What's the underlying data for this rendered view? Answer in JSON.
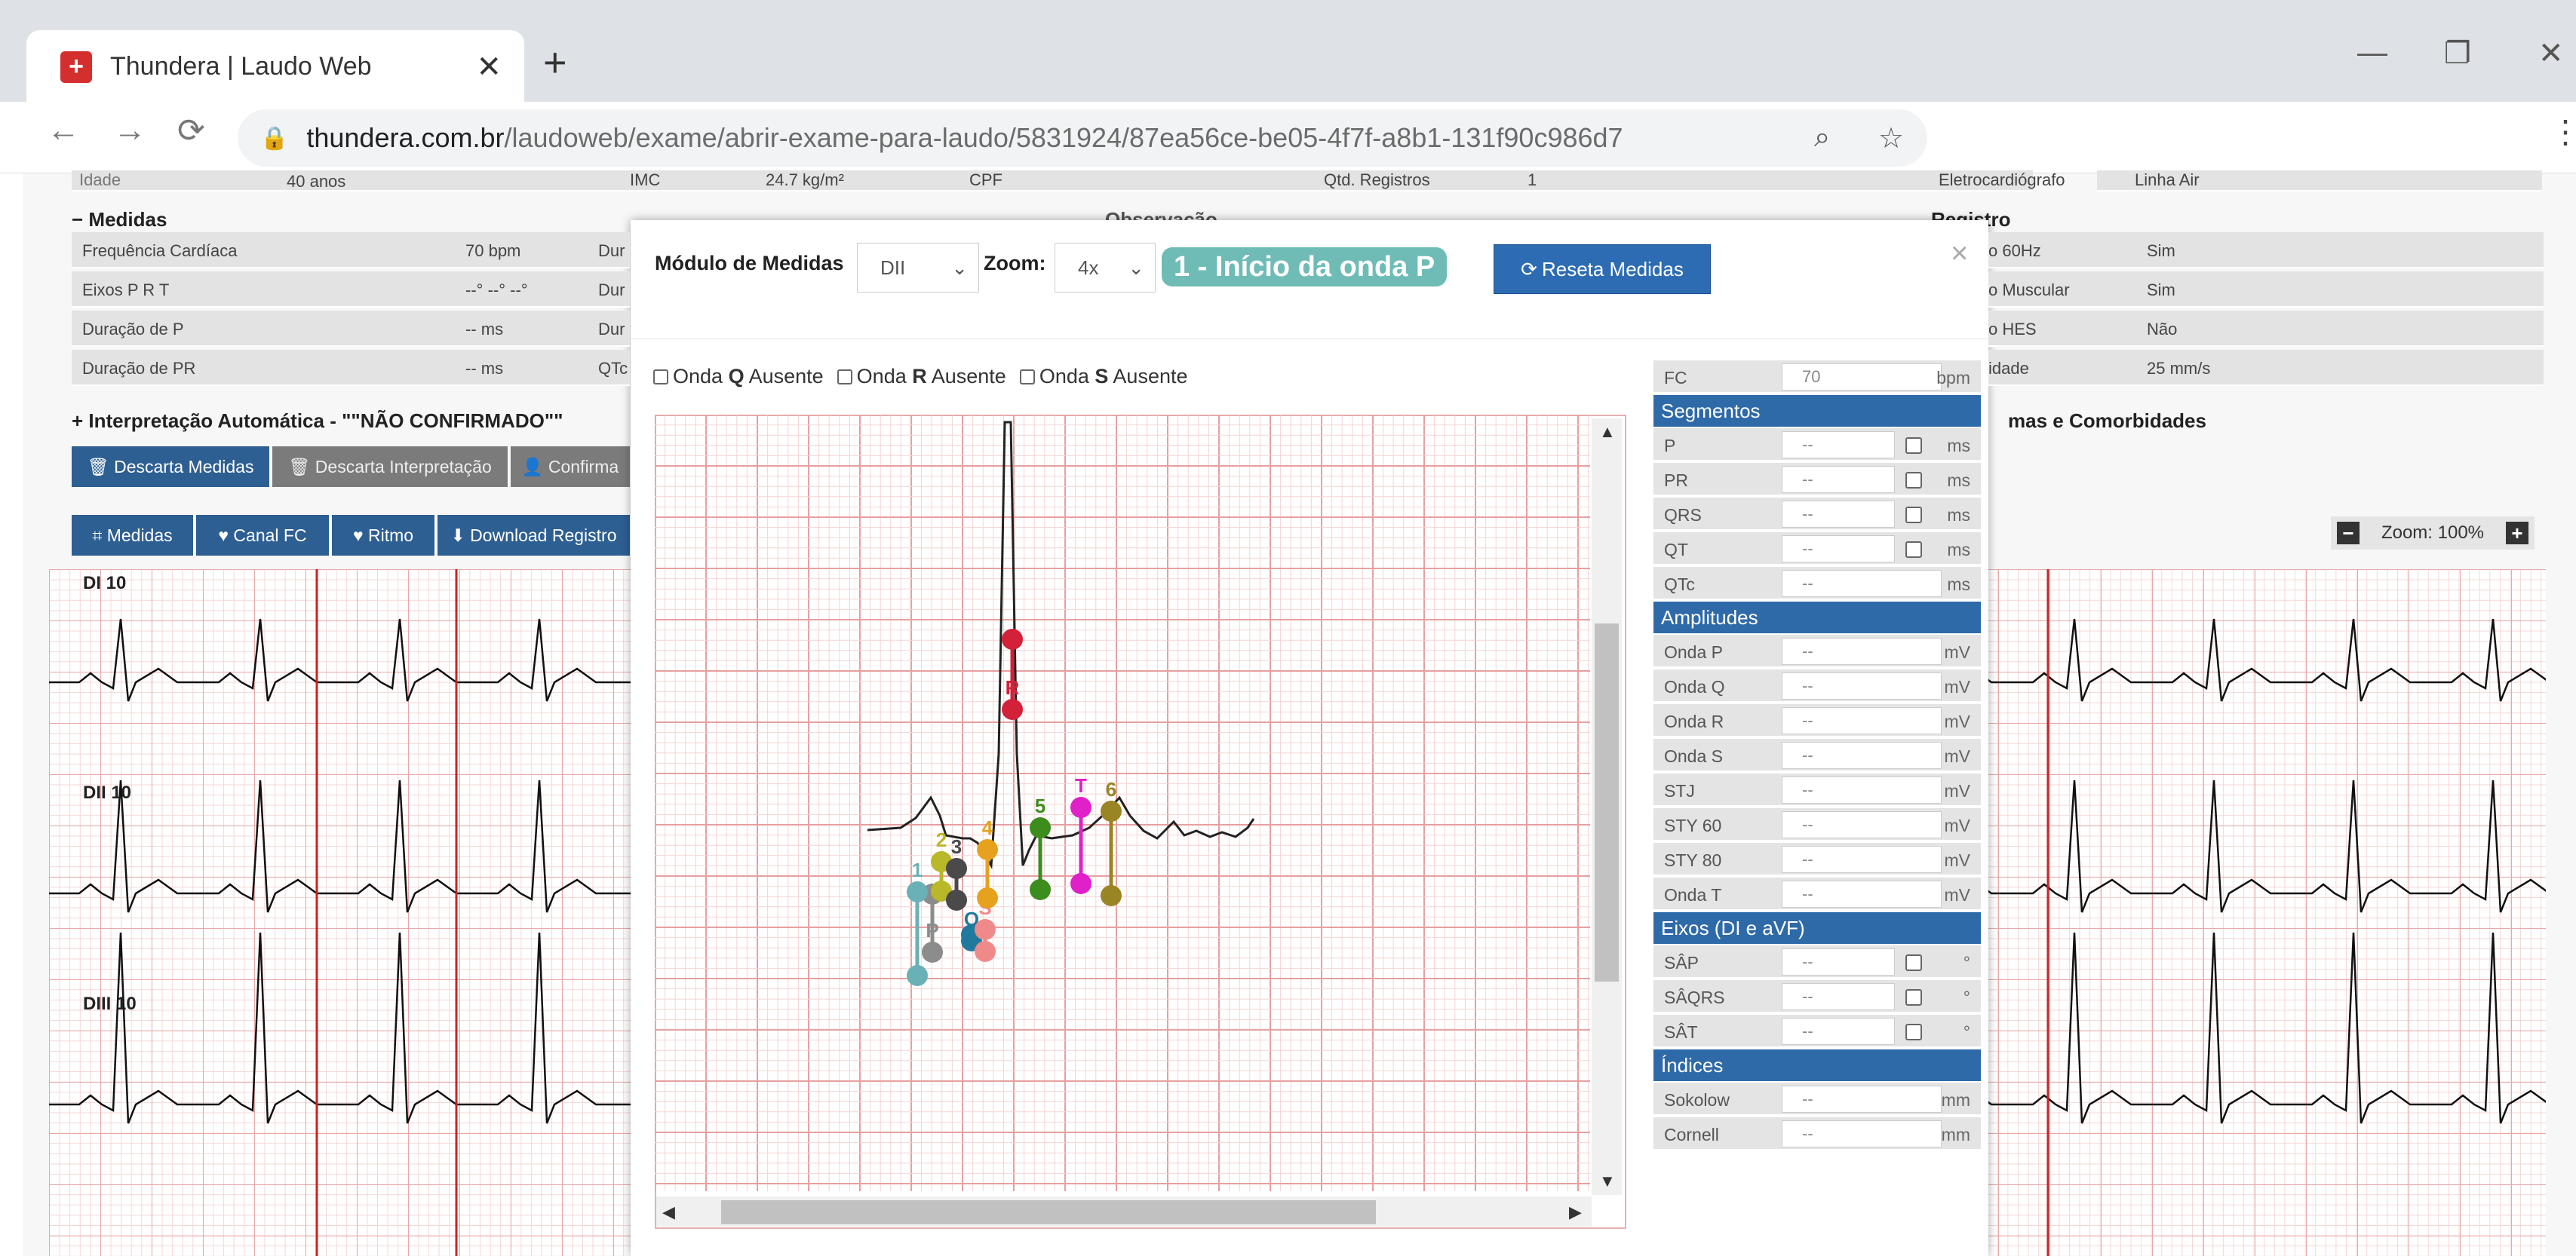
{
  "browser": {
    "tab_title": "Thundera | Laudo Web",
    "favicon": "thundera-favicon",
    "url_host": "thundera.com.br",
    "url_path": "/laudoweb/exame/abrir-exame-para-laudo/5831924/87ea56ce-be05-4f7f-a8b1-131f90c986d7"
  },
  "background": {
    "top_partial": {
      "idade_label": "Idade",
      "idade_value": "40 anos",
      "imc": "IMC",
      "imc_value": "24.7 kg/m²",
      "cpf": "CPF",
      "qtd_label": "Qtd. Registros",
      "qtd_value": "1",
      "ecg_label": "Eletrocardiógrafo",
      "ecg_value": "Linha Air"
    },
    "medidas_title": "− Medidas",
    "medidas_rows": [
      {
        "label": "Frequência Cardíaca",
        "value": "70 bpm",
        "next": "Dur"
      },
      {
        "label": "Eixos P R T",
        "value": "--° --° --°",
        "next": "Dur"
      },
      {
        "label": "Duração de P",
        "value": "-- ms",
        "next": "Dur"
      },
      {
        "label": "Duração de PR",
        "value": "-- ms",
        "next": "QTc"
      }
    ],
    "obs_partial": "Observação",
    "registro_title": "Registro",
    "registro_rows": [
      {
        "label": "o 60Hz",
        "value": "Sim"
      },
      {
        "label": "o Muscular",
        "value": "Sim"
      },
      {
        "label": "o HES",
        "value": "Não"
      },
      {
        "label": "idade",
        "value": "25 mm/s"
      }
    ],
    "interp_title": "+ Interpretação Automática - \"\"NÃO CONFIRMADO\"\"",
    "sintomas_title": "mas e Comorbidades",
    "btns_row1": [
      {
        "label": "🗑 Descarta Medidas",
        "style": "dark"
      },
      {
        "label": "🗑 Descarta Interpretação",
        "style": "gray"
      },
      {
        "label": "👤 Confirma",
        "style": "gray"
      }
    ],
    "btns_row2": [
      {
        "label": "⌗ Medidas"
      },
      {
        "label": "♥ Canal FC"
      },
      {
        "label": "♥ Ritmo"
      },
      {
        "label": "⬇ Download Registro"
      }
    ],
    "zoom_label": "Zoom: 100%",
    "leads": [
      "DI 10",
      "DII 10",
      "DIII 10"
    ]
  },
  "modal": {
    "modulo_label": "Módulo de Medidas",
    "lead_select": "DII",
    "zoom_label": "Zoom:",
    "zoom_select": "4x",
    "step_badge": "1 - Início da onda P",
    "reset_button": "Reseta Medidas",
    "close": "×",
    "checks": [
      {
        "pre": "Onda ",
        "bold": "Q",
        "post": " Ausente"
      },
      {
        "pre": "Onda ",
        "bold": "R",
        "post": " Ausente"
      },
      {
        "pre": "Onda ",
        "bold": "S",
        "post": " Ausente"
      }
    ],
    "fc": {
      "label": "FC",
      "value": "70",
      "unit": "bpm"
    },
    "segmentos_title": "Segmentos",
    "segmentos": [
      {
        "label": "P",
        "value": "--",
        "check": true,
        "unit": "ms"
      },
      {
        "label": "PR",
        "value": "--",
        "check": true,
        "unit": "ms"
      },
      {
        "label": "QRS",
        "value": "--",
        "check": true,
        "unit": "ms"
      },
      {
        "label": "QT",
        "value": "--",
        "check": true,
        "unit": "ms"
      },
      {
        "label": "QTc",
        "value": "--",
        "check": false,
        "unit": "ms"
      }
    ],
    "amplitudes_title": "Amplitudes",
    "amplitudes": [
      {
        "label": "Onda P",
        "value": "--",
        "unit": "mV"
      },
      {
        "label": "Onda Q",
        "value": "--",
        "unit": "mV"
      },
      {
        "label": "Onda R",
        "value": "--",
        "unit": "mV"
      },
      {
        "label": "Onda S",
        "value": "--",
        "unit": "mV"
      },
      {
        "label": "STJ",
        "value": "--",
        "unit": "mV"
      },
      {
        "label": "STY 60",
        "value": "--",
        "unit": "mV"
      },
      {
        "label": "STY 80",
        "value": "--",
        "unit": "mV"
      },
      {
        "label": "Onda T",
        "value": "--",
        "unit": "mV"
      }
    ],
    "eixos_title": "Eixos (DI e aVF)",
    "eixos": [
      {
        "label": "SÂP",
        "value": "--",
        "unit": "°"
      },
      {
        "label": "SÂQRS",
        "value": "--",
        "unit": "°"
      },
      {
        "label": "SÂT",
        "value": "--",
        "unit": "°"
      }
    ],
    "indices_title": "Índices",
    "indices": [
      {
        "label": "Sokolow",
        "value": "--",
        "unit": "mm"
      },
      {
        "label": "Cornell",
        "value": "--",
        "unit": "mm"
      }
    ],
    "markers": [
      {
        "label": "R",
        "color": "#d3213a"
      },
      {
        "label": "P",
        "color": "#8c8c8c"
      },
      {
        "label": "1",
        "color": "#6ab0b7"
      },
      {
        "label": "2",
        "color": "#b8b828"
      },
      {
        "label": "3",
        "color": "#4a4a4a"
      },
      {
        "label": "Q",
        "color": "#1f7a9e"
      },
      {
        "label": "S",
        "color": "#f08a8a"
      },
      {
        "label": "4",
        "color": "#e6a21e"
      },
      {
        "label": "5",
        "color": "#3d8c1e"
      },
      {
        "label": "T",
        "color": "#e020c8"
      },
      {
        "label": "6",
        "color": "#9a8524"
      }
    ]
  }
}
